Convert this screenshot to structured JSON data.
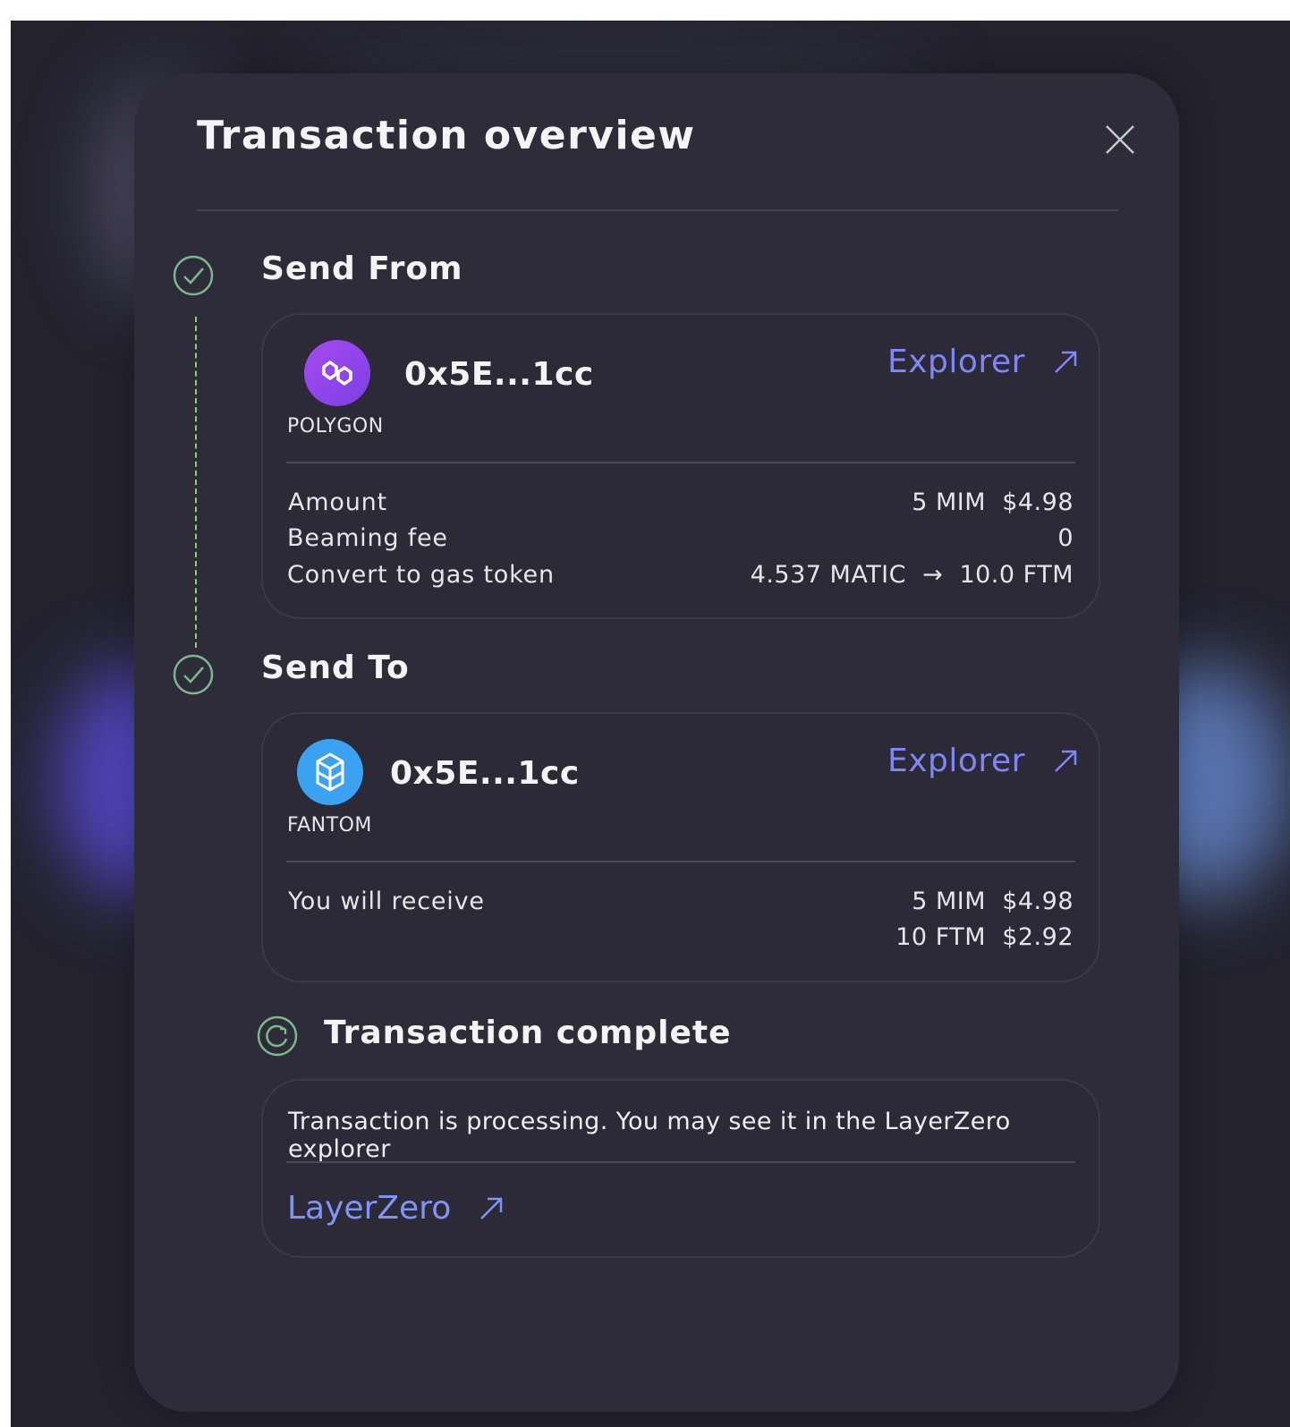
{
  "modal": {
    "title": "Transaction overview"
  },
  "send_from": {
    "title": "Send From",
    "chain": "POLYGON",
    "address": "0x5E...1cc",
    "explorer_label": "Explorer",
    "rows": [
      {
        "label": "Amount",
        "value": "5 MIM  $4.98"
      },
      {
        "label": "Beaming fee",
        "value": "0"
      },
      {
        "label": "Convert to gas token",
        "value": "4.537 MATIC  →  10.0 FTM"
      }
    ]
  },
  "send_to": {
    "title": "Send To",
    "chain": "FANTOM",
    "address": "0x5E...1cc",
    "explorer_label": "Explorer",
    "receive_label": "You will receive",
    "receive_values": [
      "5 MIM  $4.98",
      "10 FTM  $2.92"
    ]
  },
  "complete": {
    "title": "Transaction complete",
    "message": "Transaction is processing. You may see it in the LayerZero explorer",
    "link_label": "LayerZero"
  },
  "colors": {
    "accent": "#7f86f5",
    "success": "#8bd36f",
    "polygon": "#8e44ec",
    "fantom": "#3aa2f0"
  },
  "icons": [
    "close-icon",
    "check-circle-icon",
    "polygon-logo-icon",
    "fantom-logo-icon",
    "external-link-icon",
    "pending-icon"
  ]
}
